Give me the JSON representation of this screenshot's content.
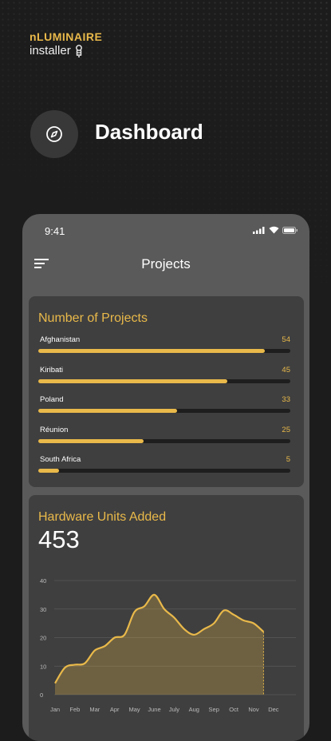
{
  "brand": {
    "name": "nLUMINAIRE",
    "sub": "installer"
  },
  "dashboard": {
    "title": "Dashboard",
    "icon": "compass-icon"
  },
  "phone": {
    "time": "9:41",
    "status_icons": [
      "signal-icon",
      "wifi-icon",
      "battery-icon"
    ],
    "title": "Projects",
    "menu_icon": "menu-icon"
  },
  "projects_card": {
    "title": "Number of Projects",
    "max": 60,
    "items": [
      {
        "label": "Afghanistan",
        "value": 54
      },
      {
        "label": "Kiribati",
        "value": 45
      },
      {
        "label": "Poland",
        "value": 33
      },
      {
        "label": "Réunion",
        "value": 25
      },
      {
        "label": "South Africa",
        "value": 5
      }
    ]
  },
  "hardware_card": {
    "title": "Hardware Units Added",
    "total": "453"
  },
  "colors": {
    "accent": "#e9b94a",
    "card": "#3f3f3f",
    "phone": "#5a5a5a",
    "background": "#1c1c1c"
  },
  "chart_data": {
    "type": "area",
    "categories": [
      "Jan",
      "Feb",
      "Mar",
      "Apr",
      "May",
      "June",
      "July",
      "Aug",
      "Sep",
      "Oct",
      "Nov",
      "Dec"
    ],
    "x": [
      0,
      0.5,
      1,
      1.5,
      2,
      2.5,
      3,
      3.5,
      4,
      4.5,
      5,
      5.5,
      6,
      6.5,
      7,
      7.5,
      8,
      8.5,
      9,
      9.5,
      10,
      10.5
    ],
    "values": [
      4,
      9.5,
      10.5,
      11,
      15.5,
      17,
      20,
      21,
      29,
      31,
      35,
      30,
      27,
      23,
      21,
      23,
      25,
      29.5,
      28,
      26,
      25,
      22
    ],
    "ylim": [
      0,
      40
    ],
    "yticks": [
      0,
      10,
      20,
      30,
      40
    ],
    "grid": true
  }
}
